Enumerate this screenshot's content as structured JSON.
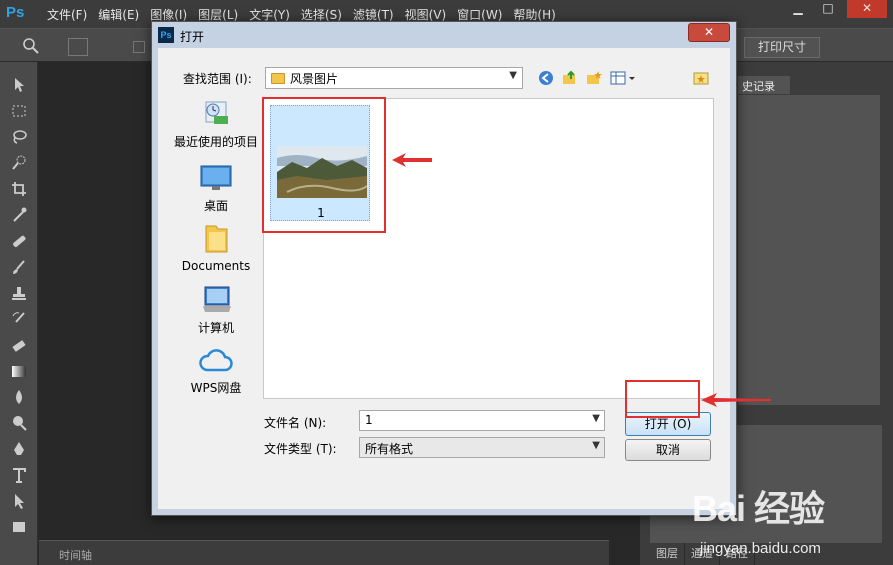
{
  "app": {
    "logo": "Ps",
    "menu": [
      "文件(F)",
      "编辑(E)",
      "图像(I)",
      "图层(L)",
      "文字(Y)",
      "选择(S)",
      "滤镜(T)",
      "视图(V)",
      "窗口(W)",
      "帮助(H)"
    ],
    "window_controls": [
      "▁",
      "□",
      "✕"
    ],
    "options_bar": {
      "print_size_label": "打印尺寸"
    },
    "panels": {
      "history_tab": "史记录",
      "bottom_tabs": [
        "图层",
        "通道",
        "路径"
      ],
      "timeline_label": "时间轴"
    }
  },
  "dialog": {
    "title": "打开",
    "close_label": "✕",
    "lookin_label": "查找范围 (I):",
    "lookin_value": "风景图片",
    "places": [
      {
        "label": "最近使用的项目",
        "icon": "recent-items-icon"
      },
      {
        "label": "桌面",
        "icon": "desktop-icon"
      },
      {
        "label": "Documents",
        "icon": "documents-folder-icon"
      },
      {
        "label": "计算机",
        "icon": "computer-icon"
      },
      {
        "label": "WPS网盘",
        "icon": "cloud-icon"
      }
    ],
    "files": [
      {
        "name": "1"
      }
    ],
    "filename_label": "文件名 (N):",
    "filename_value": "1",
    "filetype_label": "文件类型 (T):",
    "filetype_value": "所有格式",
    "open_label": "打开 (O)",
    "cancel_label": "取消"
  },
  "annotation_color": "#e03030",
  "watermark": {
    "logo": "Bai 经验",
    "site": "jingyan.baidu.com"
  }
}
